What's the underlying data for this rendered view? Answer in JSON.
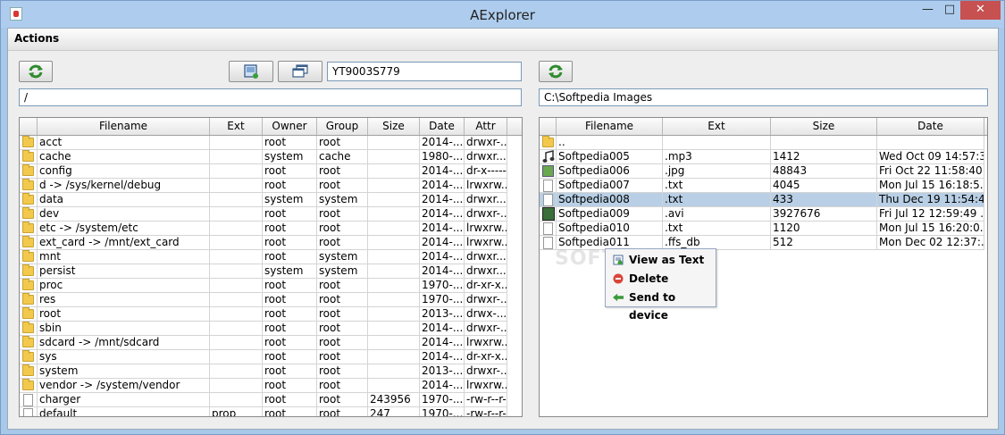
{
  "window": {
    "title": "AExplorer"
  },
  "menu": {
    "actions": "Actions"
  },
  "device": {
    "id": "YT9003S779"
  },
  "left": {
    "path": "/",
    "columns": [
      "Filename",
      "Ext",
      "Owner",
      "Group",
      "Size",
      "Date",
      "Attr"
    ],
    "rows": [
      {
        "icon": "folder",
        "name": "acct",
        "ext": "",
        "owner": "root",
        "group": "root",
        "size": "",
        "date": "2014-...",
        "attr": "drwxr-..."
      },
      {
        "icon": "folder",
        "name": "cache",
        "ext": "",
        "owner": "system",
        "group": "cache",
        "size": "",
        "date": "1980-...",
        "attr": "drwxr..."
      },
      {
        "icon": "folder",
        "name": "config",
        "ext": "",
        "owner": "root",
        "group": "root",
        "size": "",
        "date": "2014-...",
        "attr": "dr-x------"
      },
      {
        "icon": "folder",
        "name": "d -> /sys/kernel/debug",
        "ext": "",
        "owner": "root",
        "group": "root",
        "size": "",
        "date": "2014-...",
        "attr": "lrwxrw..."
      },
      {
        "icon": "folder",
        "name": "data",
        "ext": "",
        "owner": "system",
        "group": "system",
        "size": "",
        "date": "2014-...",
        "attr": "drwxr..."
      },
      {
        "icon": "folder",
        "name": "dev",
        "ext": "",
        "owner": "root",
        "group": "root",
        "size": "",
        "date": "2014-...",
        "attr": "drwxr-..."
      },
      {
        "icon": "folder",
        "name": "etc -> /system/etc",
        "ext": "",
        "owner": "root",
        "group": "root",
        "size": "",
        "date": "2014-...",
        "attr": "lrwxrw..."
      },
      {
        "icon": "folder",
        "name": "ext_card -> /mnt/ext_card",
        "ext": "",
        "owner": "root",
        "group": "root",
        "size": "",
        "date": "2014-...",
        "attr": "lrwxrw..."
      },
      {
        "icon": "folder",
        "name": "mnt",
        "ext": "",
        "owner": "root",
        "group": "system",
        "size": "",
        "date": "2014-...",
        "attr": "drwxr..."
      },
      {
        "icon": "folder",
        "name": "persist",
        "ext": "",
        "owner": "system",
        "group": "system",
        "size": "",
        "date": "2014-...",
        "attr": "drwxr..."
      },
      {
        "icon": "folder",
        "name": "proc",
        "ext": "",
        "owner": "root",
        "group": "root",
        "size": "",
        "date": "1970-...",
        "attr": "dr-xr-x..."
      },
      {
        "icon": "folder",
        "name": "res",
        "ext": "",
        "owner": "root",
        "group": "root",
        "size": "",
        "date": "1970-...",
        "attr": "drwxr-..."
      },
      {
        "icon": "folder",
        "name": "root",
        "ext": "",
        "owner": "root",
        "group": "root",
        "size": "",
        "date": "2013-...",
        "attr": "drwx-..."
      },
      {
        "icon": "folder",
        "name": "sbin",
        "ext": "",
        "owner": "root",
        "group": "root",
        "size": "",
        "date": "2014-...",
        "attr": "drwxr-..."
      },
      {
        "icon": "folder",
        "name": "sdcard -> /mnt/sdcard",
        "ext": "",
        "owner": "root",
        "group": "root",
        "size": "",
        "date": "2014-...",
        "attr": "lrwxrw..."
      },
      {
        "icon": "folder",
        "name": "sys",
        "ext": "",
        "owner": "root",
        "group": "root",
        "size": "",
        "date": "2014-...",
        "attr": "dr-xr-x..."
      },
      {
        "icon": "folder",
        "name": "system",
        "ext": "",
        "owner": "root",
        "group": "root",
        "size": "",
        "date": "2013-...",
        "attr": "drwxr-..."
      },
      {
        "icon": "folder",
        "name": "vendor -> /system/vendor",
        "ext": "",
        "owner": "root",
        "group": "root",
        "size": "",
        "date": "2014-...",
        "attr": "lrwxrw..."
      },
      {
        "icon": "file",
        "name": "charger",
        "ext": "",
        "owner": "root",
        "group": "root",
        "size": "243956",
        "date": "1970-...",
        "attr": "-rw-r--r--"
      },
      {
        "icon": "file",
        "name": "default",
        "ext": "prop",
        "owner": "root",
        "group": "root",
        "size": "247",
        "date": "1970-...",
        "attr": "-rw-r--r--"
      }
    ]
  },
  "right": {
    "path": "C:\\Softpedia Images",
    "columns": [
      "Filename",
      "Ext",
      "Size",
      "Date"
    ],
    "rows": [
      {
        "icon": "folder",
        "name": "..",
        "ext": "",
        "size": "",
        "date": ""
      },
      {
        "icon": "music",
        "name": "Softpedia005",
        "ext": ".mp3",
        "size": "1412",
        "date": "Wed Oct 09 14:57:3..."
      },
      {
        "icon": "image",
        "name": "Softpedia006",
        "ext": ".jpg",
        "size": "48843",
        "date": "Fri Oct 22 11:58:40 ..."
      },
      {
        "icon": "file",
        "name": "Softpedia007",
        "ext": ".txt",
        "size": "4045",
        "date": "Mon Jul 15 16:18:5..."
      },
      {
        "icon": "file",
        "name": "Softpedia008",
        "ext": ".txt",
        "size": "433",
        "date": "Thu Dec 19 11:54:4...",
        "selected": true
      },
      {
        "icon": "video",
        "name": "Softpedia009",
        "ext": ".avi",
        "size": "3927676",
        "date": "Fri Jul 12 12:59:49 ..."
      },
      {
        "icon": "file",
        "name": "Softpedia010",
        "ext": ".txt",
        "size": "1120",
        "date": "Mon Jul 15 16:20:0..."
      },
      {
        "icon": "file",
        "name": "Softpedia011",
        "ext": ".ffs_db",
        "size": "512",
        "date": "Mon Dec 02 12:37:..."
      }
    ]
  },
  "context_menu": {
    "items": [
      {
        "label": "View as Text",
        "icon": "text-view-icon"
      },
      {
        "label": "Delete",
        "icon": "delete-icon"
      },
      {
        "label": "Send to device",
        "icon": "send-arrow-icon"
      }
    ]
  },
  "watermark": "SOFTPEDIA"
}
